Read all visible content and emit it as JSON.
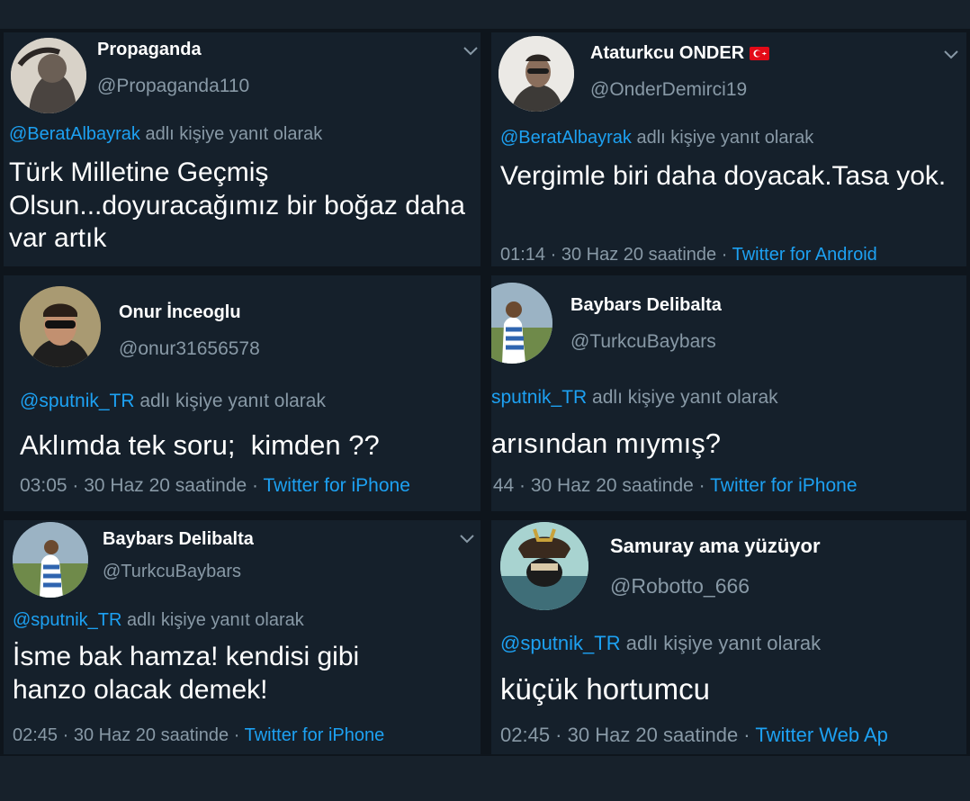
{
  "tweets": [
    {
      "name": "Propaganda",
      "handle": "@Propaganda110",
      "reply_mention": "@BeratAlbayrak",
      "reply_suffix": " adlı kişiye yanıt olarak",
      "text": "Türk Milletine Geçmiş Olsun...doyuracağımız bir boğaz daha var artık",
      "time": "",
      "date": "",
      "source": ""
    },
    {
      "name": "Ataturkcu ONDER",
      "handle": "@OnderDemirci19",
      "reply_mention": "@BeratAlbayrak",
      "reply_suffix": " adlı kişiye yanıt olarak",
      "text": "Vergimle biri daha doyacak.Tasa yok.",
      "time": "01:14",
      "date": " · 30 Haz 20 saatinde · ",
      "source": "Twitter for Android"
    },
    {
      "name": "Onur İnceoglu",
      "handle": "@onur31656578",
      "reply_mention": "@sputnik_TR",
      "reply_suffix": " adlı kişiye yanıt olarak",
      "text": "Aklımda tek soru;  kimden ??",
      "time": "03:05",
      "date": " · 30 Haz 20 saatinde · ",
      "source": "Twitter for iPhone"
    },
    {
      "name": "Baybars Delibalta",
      "handle": "@TurkcuBaybars",
      "reply_mention": "sputnik_TR",
      "reply_suffix": " adlı kişiye yanıt olarak",
      "text": "arısından mıymış?",
      "time": ":44",
      "date": " · 30 Haz 20 saatinde · ",
      "source": "Twitter for iPhone"
    },
    {
      "name": "Baybars Delibalta",
      "handle": "@TurkcuBaybars",
      "reply_mention": "@sputnik_TR",
      "reply_suffix": " adlı kişiye yanıt olarak",
      "text": "İsme bak hamza! kendisi gibi hanzo olacak demek!",
      "time": "02:45",
      "date": " · 30 Haz 20 saatinde · ",
      "source": "Twitter for iPhone"
    },
    {
      "name": "Samuray ama yüzüyor",
      "handle": "@Robotto_666",
      "reply_mention": "@sputnik_TR",
      "reply_suffix": " adlı kişiye yanıt olarak",
      "text": "küçük hortumcu",
      "time": "02:45",
      "date": " · 30 Haz 20 saatinde · ",
      "source": "Twitter Web Ap"
    }
  ],
  "colors": {
    "background": "#15202b",
    "text": "#ffffff",
    "muted": "#8899a6",
    "link": "#1da1f2"
  },
  "icons": [
    "chevron-down-icon",
    "turkey-flag-icon",
    "avatar"
  ]
}
